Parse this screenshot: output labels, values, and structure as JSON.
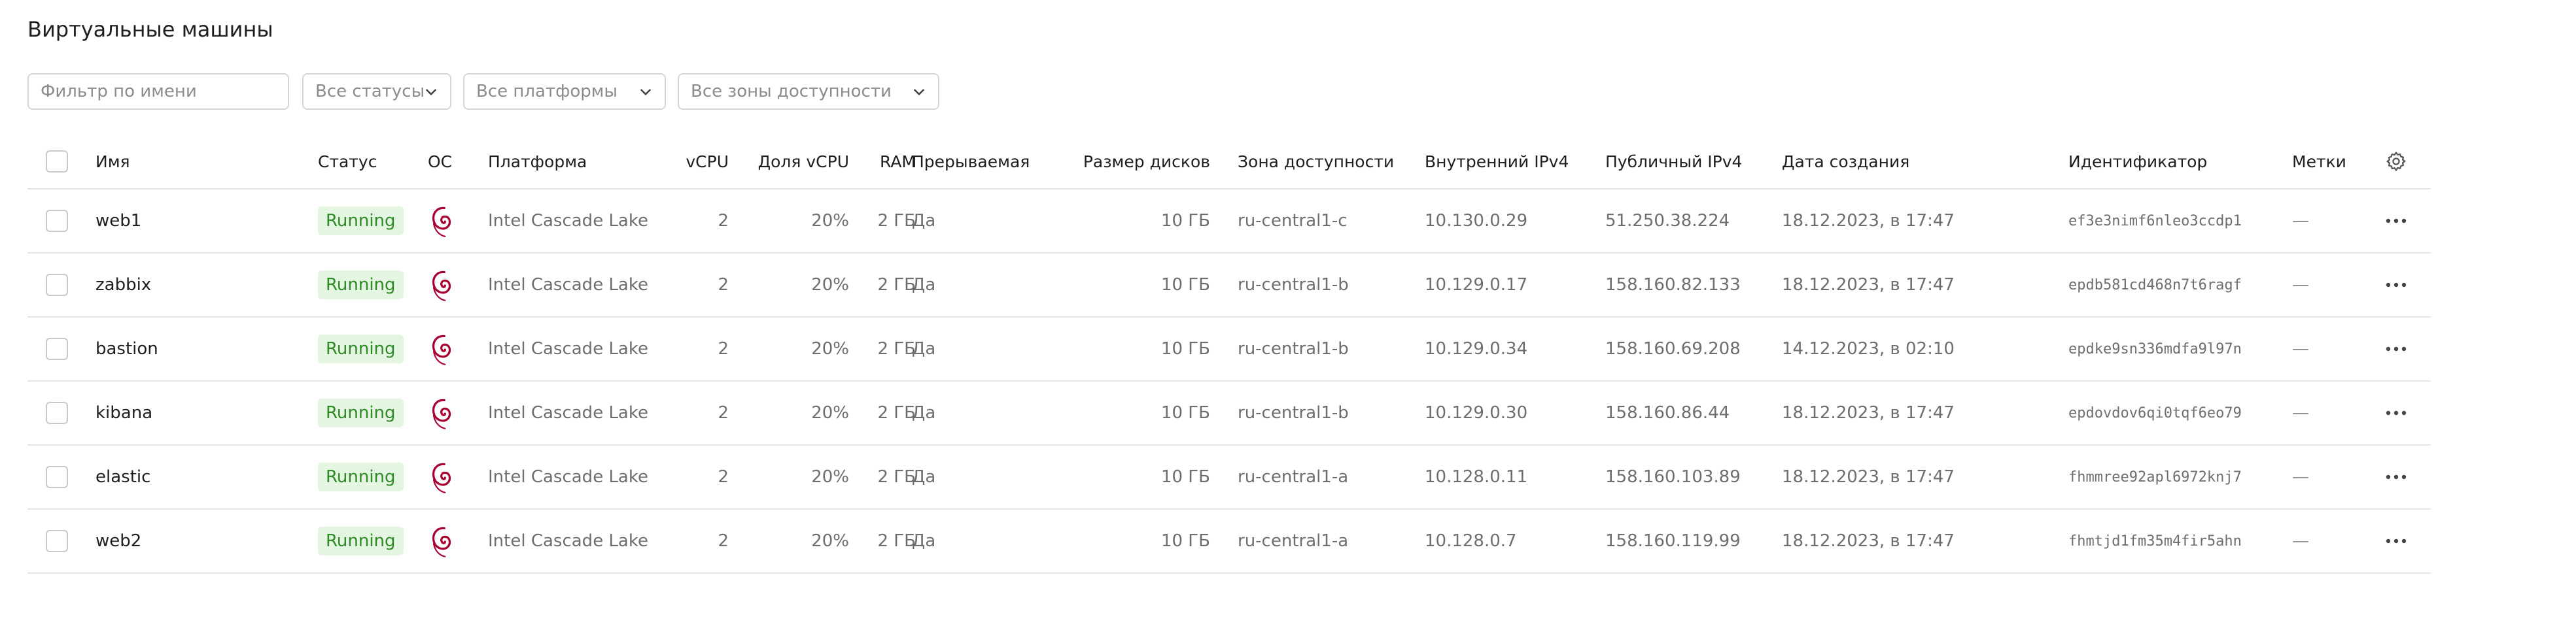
{
  "page": {
    "title": "Виртуальные машины"
  },
  "filters": {
    "name_placeholder": "Фильтр по имени",
    "status": "Все статусы",
    "platform": "Все платформы",
    "zone": "Все зоны доступности"
  },
  "columns": {
    "name": "Имя",
    "status": "Статус",
    "os": "ОС",
    "platform": "Платформа",
    "vcpu": "vCPU",
    "vcpu_share": "Доля vCPU",
    "ram": "RAM",
    "preemptible": "Прерываемая",
    "disk_size": "Размер дисков",
    "zone": "Зона доступности",
    "internal_ipv4": "Внутренний IPv4",
    "public_ipv4": "Публичный IPv4",
    "created": "Дата создания",
    "id": "Идентификатор",
    "labels": "Метки"
  },
  "rows": [
    {
      "name": "web1",
      "status": "Running",
      "platform": "Intel Cascade Lake",
      "vcpu": "2",
      "vcpu_share": "20%",
      "ram": "2 ГБ",
      "preemptible": "Да",
      "disk_size": "10 ГБ",
      "zone": "ru-central1-c",
      "internal_ipv4": "10.130.0.29",
      "public_ipv4": "51.250.38.224",
      "created": "18.12.2023, в 17:47",
      "id": "ef3e3nimf6nleo3ccdp1",
      "labels": "—"
    },
    {
      "name": "zabbix",
      "status": "Running",
      "platform": "Intel Cascade Lake",
      "vcpu": "2",
      "vcpu_share": "20%",
      "ram": "2 ГБ",
      "preemptible": "Да",
      "disk_size": "10 ГБ",
      "zone": "ru-central1-b",
      "internal_ipv4": "10.129.0.17",
      "public_ipv4": "158.160.82.133",
      "created": "18.12.2023, в 17:47",
      "id": "epdb581cd468n7t6ragf",
      "labels": "—"
    },
    {
      "name": "bastion",
      "status": "Running",
      "platform": "Intel Cascade Lake",
      "vcpu": "2",
      "vcpu_share": "20%",
      "ram": "2 ГБ",
      "preemptible": "Да",
      "disk_size": "10 ГБ",
      "zone": "ru-central1-b",
      "internal_ipv4": "10.129.0.34",
      "public_ipv4": "158.160.69.208",
      "created": "14.12.2023, в 02:10",
      "id": "epdke9sn336mdfa9l97n",
      "labels": "—"
    },
    {
      "name": "kibana",
      "status": "Running",
      "platform": "Intel Cascade Lake",
      "vcpu": "2",
      "vcpu_share": "20%",
      "ram": "2 ГБ",
      "preemptible": "Да",
      "disk_size": "10 ГБ",
      "zone": "ru-central1-b",
      "internal_ipv4": "10.129.0.30",
      "public_ipv4": "158.160.86.44",
      "created": "18.12.2023, в 17:47",
      "id": "epdovdov6qi0tqf6eo79",
      "labels": "—"
    },
    {
      "name": "elastic",
      "status": "Running",
      "platform": "Intel Cascade Lake",
      "vcpu": "2",
      "vcpu_share": "20%",
      "ram": "2 ГБ",
      "preemptible": "Да",
      "disk_size": "10 ГБ",
      "zone": "ru-central1-a",
      "internal_ipv4": "10.128.0.11",
      "public_ipv4": "158.160.103.89",
      "created": "18.12.2023, в 17:47",
      "id": "fhmmree92apl6972knj7",
      "labels": "—"
    },
    {
      "name": "web2",
      "status": "Running",
      "platform": "Intel Cascade Lake",
      "vcpu": "2",
      "vcpu_share": "20%",
      "ram": "2 ГБ",
      "preemptible": "Да",
      "disk_size": "10 ГБ",
      "zone": "ru-central1-a",
      "internal_ipv4": "10.128.0.7",
      "public_ipv4": "158.160.119.99",
      "created": "18.12.2023, в 17:47",
      "id": "fhmtjd1fm35m4fir5ahn",
      "labels": "—"
    }
  ],
  "icons": {
    "os": "debian-swirl-icon",
    "row_menu": "more-horizontal-icon",
    "settings": "gear-icon"
  },
  "colors": {
    "status_bg": "#e4f5e2",
    "status_text": "#2f8a26",
    "debian_red": "#a80030"
  }
}
